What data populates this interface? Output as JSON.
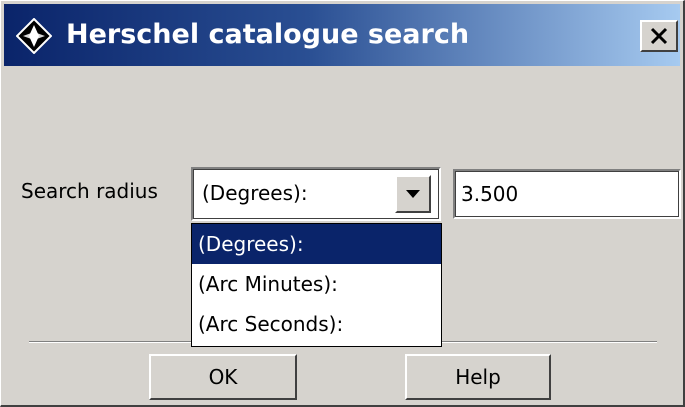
{
  "window": {
    "title": "Herschel catalogue search",
    "icon": "diamond-compass-icon",
    "close_icon": "close-icon",
    "titlebar_colors": [
      "#0a246a",
      "#a6caf0"
    ]
  },
  "form": {
    "search_radius_label": "Search radius",
    "unit_select": {
      "selected": "(Degrees):",
      "options": [
        "(Degrees):",
        "(Arc Minutes):",
        "(Arc Seconds):"
      ]
    },
    "radius_value": "3.500"
  },
  "buttons": {
    "ok": "OK",
    "help": "Help"
  }
}
